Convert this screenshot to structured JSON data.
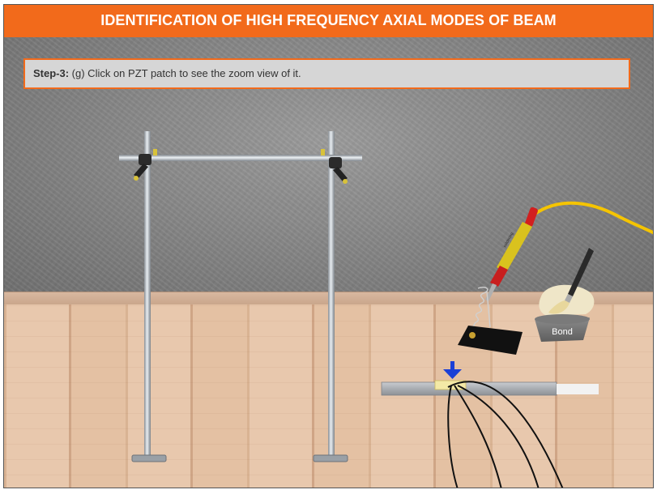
{
  "title": "IDENTIFICATION OF HIGH FREQUENCY AXIAL MODES OF BEAM",
  "instruction": {
    "step_label": "Step-3:",
    "text": " (g) Click on PZT patch to see the zoom view of it."
  },
  "bond_label": "Bond",
  "colors": {
    "accent": "#f26a1b",
    "arrow": "#1a3fd6",
    "wire": "#f5c400",
    "pzt_patch": "#f3e9a6"
  },
  "icons": [
    "soldering-iron-icon",
    "bond-bowl-icon",
    "brush-icon",
    "down-arrow-icon"
  ]
}
